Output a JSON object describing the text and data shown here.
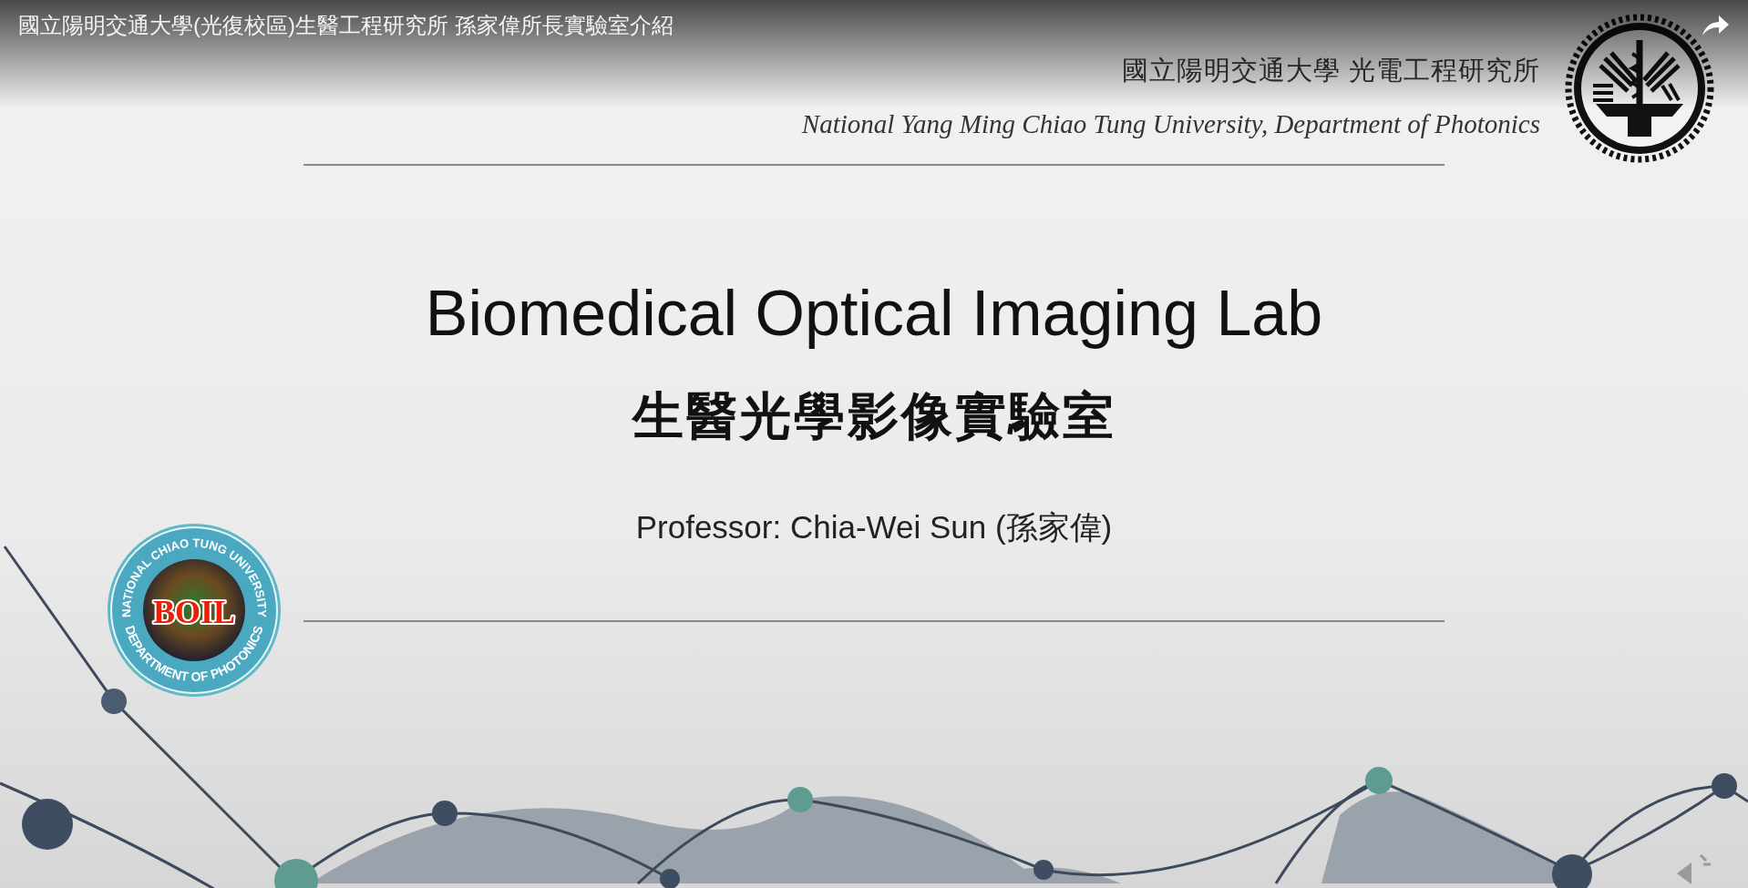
{
  "player": {
    "title": "國立陽明交通大學(光復校區)生醫工程研究所 孫家偉所長實驗室介紹"
  },
  "slide": {
    "header_zh": "國立陽明交通大學 光電工程研究所",
    "header_en": "National Yang Ming Chiao Tung University, Department of Photonics",
    "title": "Biomedical Optical Imaging Lab",
    "subtitle": "生醫光學影像實驗室",
    "professor": "Professor: Chia-Wei Sun (孫家偉)",
    "lab_logo": {
      "ring_text_top": "NATIONAL CHIAO TUNG UNIVERSITY",
      "ring_text_bottom": "DEPARTMENT OF PHOTONICS",
      "center_text": "BOIL"
    }
  }
}
